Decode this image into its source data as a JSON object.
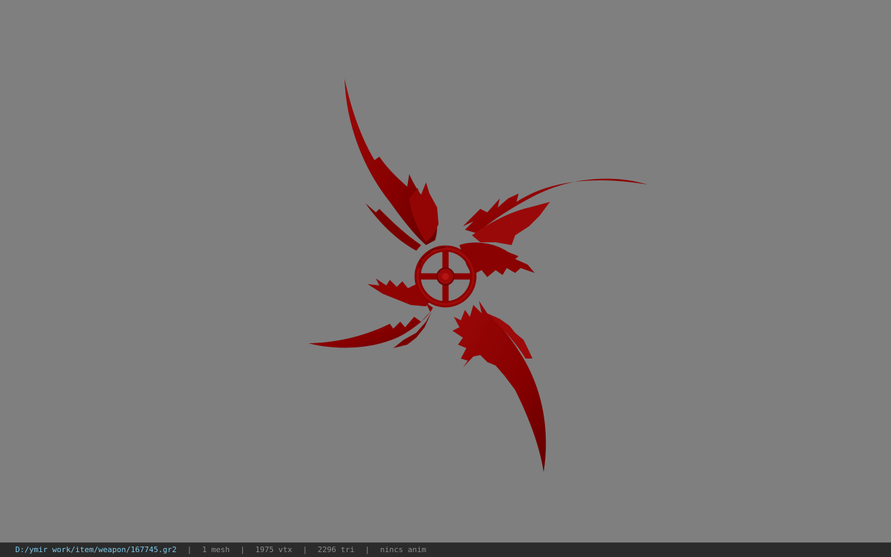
{
  "viewport": {
    "background_color": "#7f7f7f",
    "model_color": "#8b0000",
    "model_highlight": "#a30d0d",
    "model_shadow": "#5e0000"
  },
  "statusbar": {
    "file_path": "D:/ymir work/item/weapon/167745.gr2",
    "separator": "|",
    "mesh_count": "1 mesh",
    "vertex_count": "1975 vtx",
    "triangle_count": "2296 tri",
    "animation": "nincs anim",
    "path_color": "#7fc8e8",
    "text_color": "#8c8c8c"
  }
}
